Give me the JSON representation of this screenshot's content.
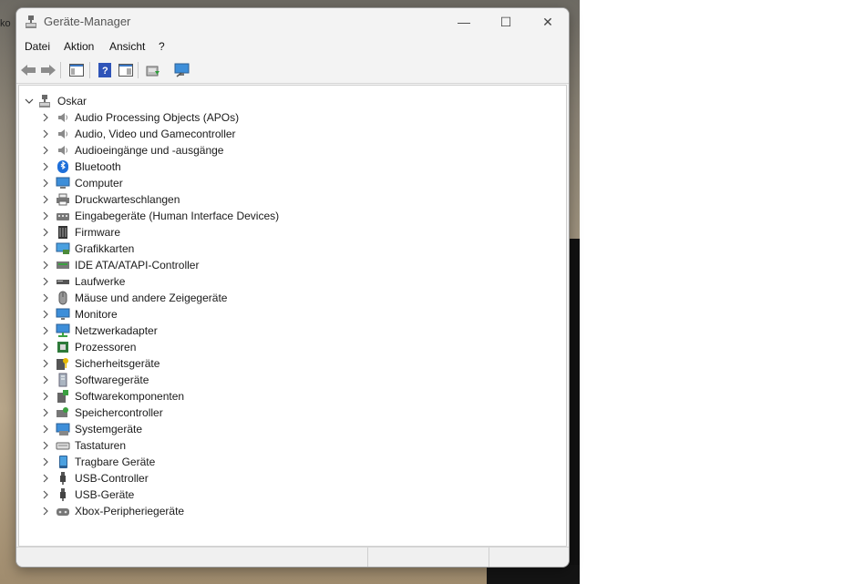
{
  "desktop": {
    "clipped_label": "ko"
  },
  "window": {
    "title": "Geräte-Manager"
  },
  "window_buttons": {
    "minimize": "—",
    "maximize": "☐",
    "close": "✕"
  },
  "menu": [
    "Datei",
    "Aktion",
    "Ansicht",
    "?"
  ],
  "tree": {
    "root": "Oskar",
    "items": [
      {
        "label": "Audio Processing Objects (APOs)",
        "icon": "speaker-icon"
      },
      {
        "label": "Audio, Video und Gamecontroller",
        "icon": "speaker-icon"
      },
      {
        "label": "Audioeingänge und -ausgänge",
        "icon": "speaker-icon"
      },
      {
        "label": "Bluetooth",
        "icon": "bluetooth-icon"
      },
      {
        "label": "Computer",
        "icon": "computer-icon"
      },
      {
        "label": "Druckwarteschlangen",
        "icon": "printer-icon"
      },
      {
        "label": "Eingabegeräte (Human Interface Devices)",
        "icon": "hid-icon"
      },
      {
        "label": "Firmware",
        "icon": "firmware-icon"
      },
      {
        "label": "Grafikkarten",
        "icon": "display-adapter-icon"
      },
      {
        "label": "IDE ATA/ATAPI-Controller",
        "icon": "ide-controller-icon"
      },
      {
        "label": "Laufwerke",
        "icon": "disk-drive-icon"
      },
      {
        "label": "Mäuse und andere Zeigegeräte",
        "icon": "mouse-icon"
      },
      {
        "label": "Monitore",
        "icon": "monitor-icon"
      },
      {
        "label": "Netzwerkadapter",
        "icon": "network-adapter-icon"
      },
      {
        "label": "Prozessoren",
        "icon": "processor-icon"
      },
      {
        "label": "Sicherheitsgeräte",
        "icon": "security-device-icon"
      },
      {
        "label": "Softwaregeräte",
        "icon": "software-device-icon"
      },
      {
        "label": "Softwarekomponenten",
        "icon": "software-component-icon"
      },
      {
        "label": "Speichercontroller",
        "icon": "storage-controller-icon"
      },
      {
        "label": "Systemgeräte",
        "icon": "system-device-icon"
      },
      {
        "label": "Tastaturen",
        "icon": "keyboard-icon"
      },
      {
        "label": "Tragbare Geräte",
        "icon": "portable-device-icon"
      },
      {
        "label": "USB-Controller",
        "icon": "usb-icon"
      },
      {
        "label": "USB-Geräte",
        "icon": "usb-icon"
      },
      {
        "label": "Xbox-Peripheriegeräte",
        "icon": "xbox-peripheral-icon"
      }
    ]
  }
}
